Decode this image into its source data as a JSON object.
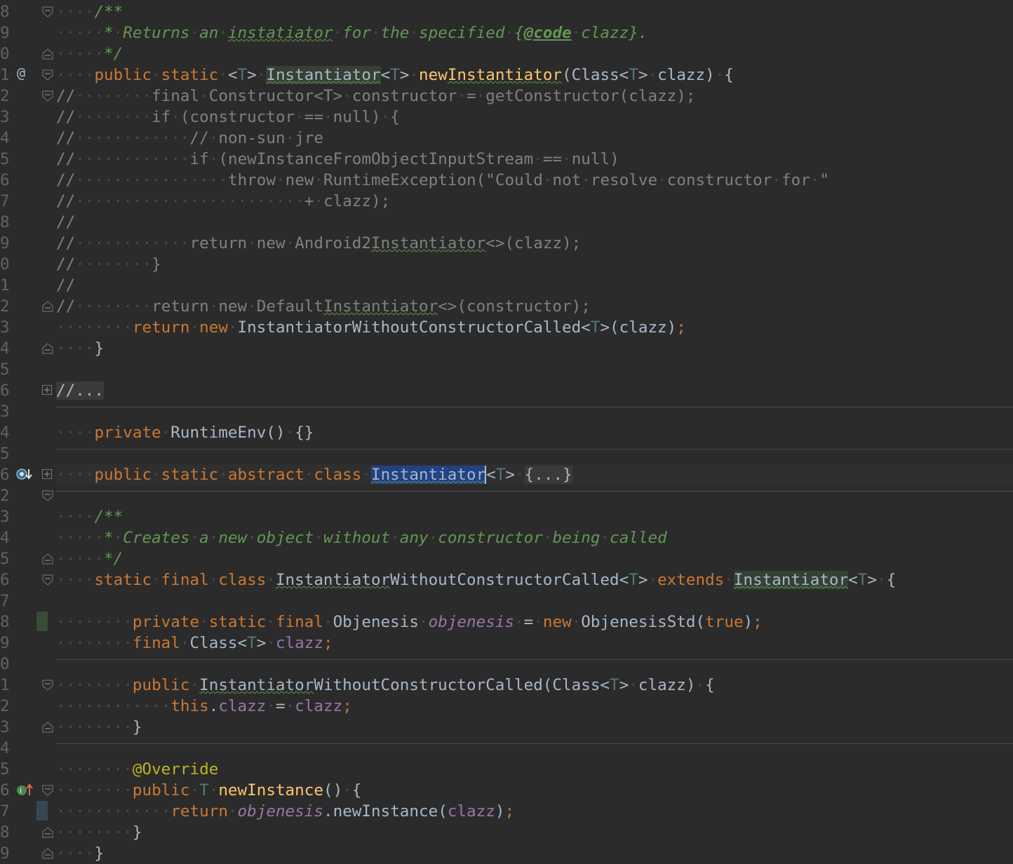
{
  "editor": {
    "lines": [
      {
        "num": "8",
        "text": "    /**"
      },
      {
        "num": "9",
        "text": "     * Returns an instatiator for the specified {@code clazz}."
      },
      {
        "num": "0",
        "text": "     */"
      },
      {
        "num": "1",
        "gutter": "@",
        "text": "    public static <T> Instantiator<T> newInstantiator(Class<T> clazz) {"
      },
      {
        "num": "2",
        "text": "//        final Constructor<T> constructor = getConstructor(clazz);"
      },
      {
        "num": "3",
        "text": "//        if (constructor == null) {"
      },
      {
        "num": "4",
        "text": "//            // non-sun jre"
      },
      {
        "num": "5",
        "text": "//            if (newInstanceFromObjectInputStream == null)"
      },
      {
        "num": "6",
        "text": "//                throw new RuntimeException(\"Could not resolve constructor for \""
      },
      {
        "num": "7",
        "text": "//                        + clazz);"
      },
      {
        "num": "8",
        "text": "//"
      },
      {
        "num": "9",
        "text": "//            return new Android2Instantiator<>(clazz);"
      },
      {
        "num": "0",
        "text": "//        }"
      },
      {
        "num": "1",
        "text": "//"
      },
      {
        "num": "2",
        "text": "//        return new DefaultInstantiator<>(constructor);"
      },
      {
        "num": "3",
        "text": "        return new InstantiatorWithoutConstructorCalled<T>(clazz);"
      },
      {
        "num": "4",
        "text": "    }"
      },
      {
        "num": "5",
        "text": ""
      },
      {
        "num": "6",
        "text": "//..."
      },
      {
        "num": "3",
        "text": ""
      },
      {
        "num": "4",
        "text": "    private RuntimeEnv() {}"
      },
      {
        "num": "5",
        "text": ""
      },
      {
        "num": "6",
        "text": "    public static abstract class Instantiator<T> {...}"
      },
      {
        "num": "2",
        "text": ""
      },
      {
        "num": "3",
        "text": "    /**"
      },
      {
        "num": "4",
        "text": "     * Creates a new object without any constructor being called"
      },
      {
        "num": "5",
        "text": "     */"
      },
      {
        "num": "6",
        "text": "    static final class InstantiatorWithoutConstructorCalled<T> extends Instantiator<T> {"
      },
      {
        "num": "7",
        "text": ""
      },
      {
        "num": "8",
        "text": "        private static final Objenesis objenesis = new ObjenesisStd(true);"
      },
      {
        "num": "9",
        "text": "        final Class<T> clazz;"
      },
      {
        "num": "0",
        "text": ""
      },
      {
        "num": "1",
        "text": "        public InstantiatorWithoutConstructorCalled(Class<T> clazz) {"
      },
      {
        "num": "2",
        "text": "            this.clazz = clazz;"
      },
      {
        "num": "3",
        "text": "        }"
      },
      {
        "num": "4",
        "text": ""
      },
      {
        "num": "5",
        "text": "        @Override"
      },
      {
        "num": "6",
        "text": "        public T newInstance() {"
      },
      {
        "num": "7",
        "text": "            return objenesis.newInstance(clazz);"
      },
      {
        "num": "8",
        "text": "        }"
      },
      {
        "num": "9",
        "text": "    }"
      }
    ],
    "folded_placeholder": "//...",
    "folded_class_body": "{...}"
  },
  "colors": {
    "background": "#2b2b2b",
    "keyword": "#cc7832",
    "doc_comment": "#629755",
    "line_comment": "#808080",
    "method": "#ffc66d",
    "field": "#9876aa",
    "annotation": "#bbb529",
    "selection": "#214283"
  },
  "icons": {
    "line1": "override-at-icon",
    "line6": "implemented-by-icon",
    "line36": "implements-method-icon"
  }
}
